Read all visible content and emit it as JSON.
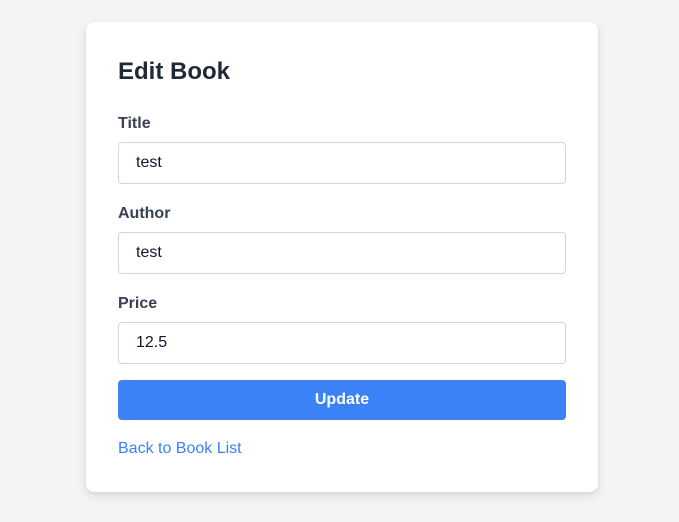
{
  "page": {
    "title": "Edit Book"
  },
  "form": {
    "title_label": "Title",
    "title_value": "test",
    "author_label": "Author",
    "author_value": "test",
    "price_label": "Price",
    "price_value": "12.5",
    "submit_label": "Update"
  },
  "links": {
    "back_label": "Back to Book List"
  },
  "colors": {
    "background": "#f3f4f6",
    "card": "#ffffff",
    "accent": "#3b82f6",
    "heading": "#1f2937",
    "label": "#374151",
    "input_border": "#d1d5db"
  }
}
